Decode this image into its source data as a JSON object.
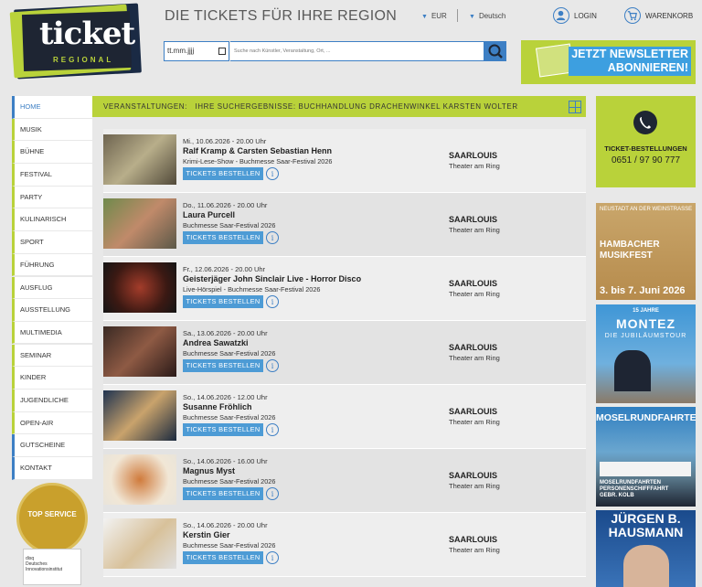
{
  "logo": {
    "word": "ticket",
    "sub": "REGIONAL"
  },
  "header": {
    "title": "DIE TICKETS FÜR IHRE REGION",
    "currency": "EUR",
    "language": "Deutsch",
    "login": "LOGIN",
    "cart": "WARENKORB"
  },
  "search": {
    "date_placeholder": "tt.mm.jjjj",
    "query_placeholder": "Suche nach Künstler, Veranstaltung, Ort, ..."
  },
  "newsletter": {
    "line1": "JETZT NEWSLETTER",
    "line2": "ABONNIEREN!"
  },
  "nav": [
    {
      "label": "HOME"
    },
    {
      "label": "MUSIK"
    },
    {
      "label": "BÜHNE"
    },
    {
      "label": "FESTIVAL"
    },
    {
      "label": "PARTY"
    },
    {
      "label": "KULINARISCH"
    },
    {
      "label": "SPORT"
    },
    {
      "label": "FÜHRUNG"
    },
    {
      "label": "AUSFLUG"
    },
    {
      "label": "AUSSTELLUNG"
    },
    {
      "label": "MULTIMEDIA"
    },
    {
      "label": "SEMINAR"
    },
    {
      "label": "KINDER"
    },
    {
      "label": "JUGENDLICHE"
    },
    {
      "label": "OPEN-AIR"
    },
    {
      "label": "GUTSCHEINE"
    },
    {
      "label": "KONTAKT"
    }
  ],
  "seal": {
    "top": "TOP SERVICE",
    "ribbon1": "disq",
    "ribbon2": "Deutsches",
    "ribbon3": "Innovationsinstitut"
  },
  "results": {
    "label": "VERANSTALTUNGEN:",
    "text": "IHRE SUCHERGEBNISSE: BUCHHANDLUNG DRACHENWINKEL KARSTEN WOLTER"
  },
  "button_label": "TICKETS BESTELLEN",
  "events": [
    {
      "date": "Mi., 10.06.2026 - 20.00 Uhr",
      "name": "Ralf Kramp & Carsten Sebastian Henn",
      "sub": "Krimi-Lese-Show - Buchmesse Saar-Festival 2026",
      "city": "SAARLOUIS",
      "venue": "Theater am Ring"
    },
    {
      "date": "Do., 11.06.2026 - 20.00 Uhr",
      "name": "Laura Purcell",
      "sub": "Buchmesse Saar-Festival 2026",
      "city": "SAARLOUIS",
      "venue": "Theater am Ring"
    },
    {
      "date": "Fr., 12.06.2026 - 20.00 Uhr",
      "name": "Geisterjäger John Sinclair Live - Horror Disco",
      "sub": "Live-Hörspiel - Buchmesse Saar-Festival 2026",
      "city": "SAARLOUIS",
      "venue": "Theater am Ring"
    },
    {
      "date": "Sa., 13.06.2026 - 20.00 Uhr",
      "name": "Andrea Sawatzki",
      "sub": "Buchmesse Saar-Festival 2026",
      "city": "SAARLOUIS",
      "venue": "Theater am Ring"
    },
    {
      "date": "So., 14.06.2026 - 12.00 Uhr",
      "name": "Susanne Fröhlich",
      "sub": "Buchmesse Saar-Festival 2026",
      "city": "SAARLOUIS",
      "venue": "Theater am Ring"
    },
    {
      "date": "So., 14.06.2026 - 16.00 Uhr",
      "name": "Magnus Myst",
      "sub": "Buchmesse Saar-Festival 2026",
      "city": "SAARLOUIS",
      "venue": "Theater am Ring"
    },
    {
      "date": "So., 14.06.2026 - 20.00 Uhr",
      "name": "Kerstin Gier",
      "sub": "Buchmesse Saar-Festival 2026",
      "city": "SAARLOUIS",
      "venue": "Theater am Ring"
    }
  ],
  "hotline": {
    "label": "TICKET-BESTELLUNGEN",
    "number": "0651 / 97 90 777"
  },
  "ads": {
    "hambach": {
      "top": "NEUSTADT AN DER WEINSTRASSE",
      "title1": "HAMBACHER",
      "title2": "MUSIKFEST",
      "dates": "3. bis 7. Juni 2026"
    },
    "montez": {
      "top": "15 JAHRE",
      "title": "MONTEZ",
      "sub": "DIE JUBILÄUMSTOUR"
    },
    "mosel": {
      "title": "MOSELRUNDFAHRTEN",
      "line1": "MOSELRUNDFAHRTEN",
      "line2": "PERSONENSCHIFFFAHRT",
      "line3": "GEBR. KOLB"
    },
    "hausmann": {
      "line1": "JÜRGEN B.",
      "line2": "HAUSMANN"
    }
  },
  "colors": {
    "green": "#b9d23a",
    "blue": "#3d7fc4",
    "button": "#4d9bd5",
    "navy": "#1e2533"
  }
}
